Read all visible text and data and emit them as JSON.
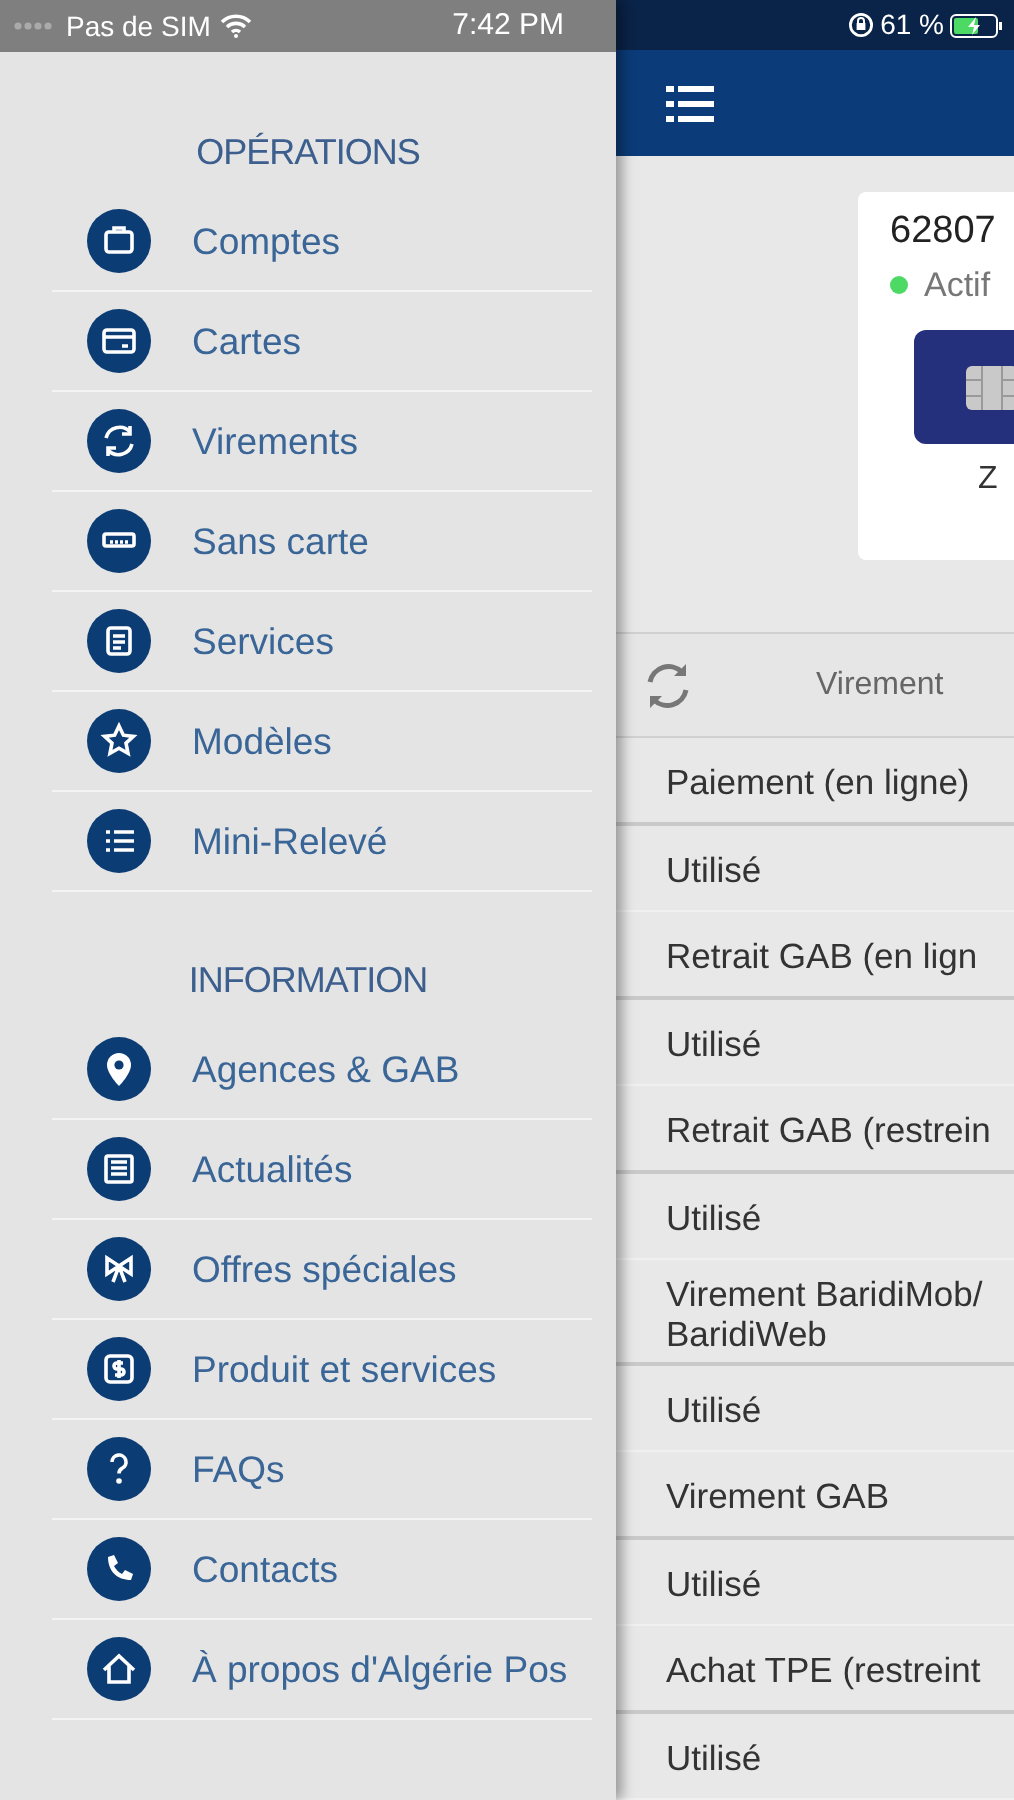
{
  "status_bar": {
    "carrier": "Pas de SIM",
    "time": "7:42 PM",
    "battery": "61 %"
  },
  "drawer": {
    "sections": [
      {
        "title": "OPÉRATIONS",
        "items": [
          {
            "label": "Comptes"
          },
          {
            "label": "Cartes"
          },
          {
            "label": "Virements"
          },
          {
            "label": "Sans carte"
          },
          {
            "label": "Services"
          },
          {
            "label": "Modèles"
          },
          {
            "label": "Mini-Relevé"
          }
        ]
      },
      {
        "title": "INFORMATION",
        "items": [
          {
            "label": "Agences & GAB"
          },
          {
            "label": "Actualités"
          },
          {
            "label": "Offres spéciales"
          },
          {
            "label": "Produit et services"
          },
          {
            "label": "FAQs"
          },
          {
            "label": "Contacts"
          },
          {
            "label": "À propos d'Algérie Pos"
          }
        ]
      }
    ]
  },
  "main": {
    "card": {
      "number": "62807",
      "status": "Actif",
      "active": true,
      "holder": "Z"
    },
    "tab": "Virement",
    "rows": [
      {
        "text": "Paiement (en ligne)",
        "kind": "label"
      },
      {
        "text": "Utilisé",
        "kind": "value"
      },
      {
        "text": "Retrait GAB (en lign",
        "kind": "label"
      },
      {
        "text": "Utilisé",
        "kind": "value"
      },
      {
        "text": "Retrait GAB (restrein",
        "kind": "label"
      },
      {
        "text": "Utilisé",
        "kind": "value"
      },
      {
        "text": "Virement BaridiMob/ BaridiWeb",
        "kind": "label"
      },
      {
        "text": "Utilisé",
        "kind": "value"
      },
      {
        "text": "Virement GAB",
        "kind": "label"
      },
      {
        "text": "Utilisé",
        "kind": "value"
      },
      {
        "text": "Achat TPE (restreint",
        "kind": "label"
      },
      {
        "text": "Utilisé",
        "kind": "value"
      }
    ]
  }
}
